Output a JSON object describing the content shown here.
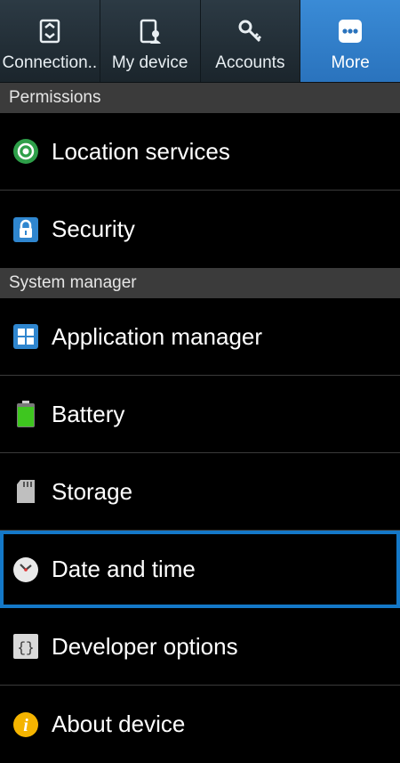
{
  "tabs": [
    {
      "label": "Connection..",
      "icon": "connections-icon"
    },
    {
      "label": "My device",
      "icon": "my-device-icon"
    },
    {
      "label": "Accounts",
      "icon": "accounts-icon"
    },
    {
      "label": "More",
      "icon": "more-icon",
      "active": true
    }
  ],
  "sections": {
    "permissions": "Permissions",
    "system_manager": "System manager"
  },
  "items": {
    "location": {
      "label": "Location services",
      "icon": "location-icon"
    },
    "security": {
      "label": "Security",
      "icon": "lock-icon"
    },
    "application_manager": {
      "label": "Application manager",
      "icon": "app-grid-icon"
    },
    "battery": {
      "label": "Battery",
      "icon": "battery-icon"
    },
    "storage": {
      "label": "Storage",
      "icon": "sd-card-icon"
    },
    "date_time": {
      "label": "Date and time",
      "icon": "clock-icon",
      "selected": true
    },
    "developer": {
      "label": "Developer options",
      "icon": "braces-icon"
    },
    "about": {
      "label": "About device",
      "icon": "info-icon"
    }
  },
  "colors": {
    "tab_active": "#2f7fcd",
    "section_bg": "#3b3b3b",
    "selection_border": "#1478c8"
  }
}
